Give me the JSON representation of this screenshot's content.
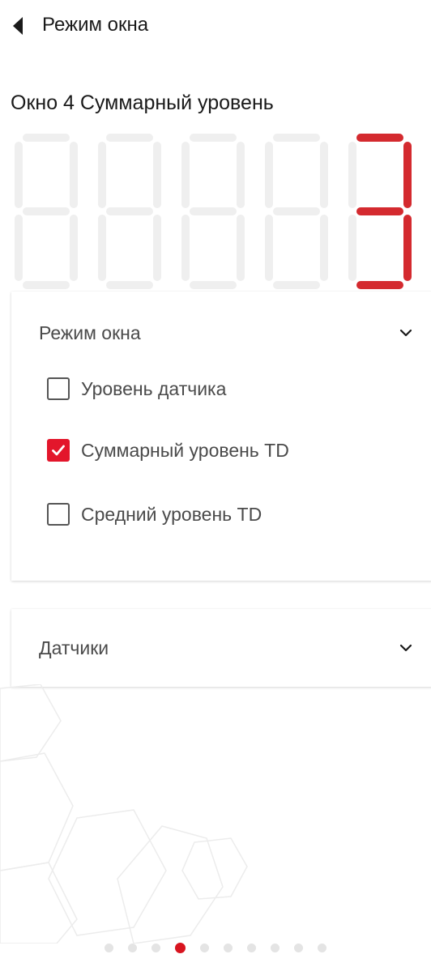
{
  "header": {
    "title": "Режим окна"
  },
  "window_title": "Окно 4 Суммарный уровень",
  "display": {
    "digit_count": 5,
    "active_digit_index": 4,
    "active_digit_value": "3",
    "active_color": "#d42a2f",
    "inactive_color": "#efefef"
  },
  "mode_panel": {
    "title": "Режим окна",
    "options": [
      {
        "label": "Уровень датчика",
        "checked": false
      },
      {
        "label": "Суммарный уровень TD",
        "checked": true
      },
      {
        "label": "Средний уровень TD",
        "checked": false
      }
    ]
  },
  "sensors_panel": {
    "title": "Датчики"
  },
  "pager": {
    "total": 10,
    "active_index": 3
  },
  "colors": {
    "accent": "#e3162b",
    "text": "#1a1a1a",
    "muted_text": "#4a4a4a"
  },
  "icons": {
    "back": "back-arrow-icon",
    "chevron": "chevron-down-icon",
    "check": "check-icon"
  }
}
